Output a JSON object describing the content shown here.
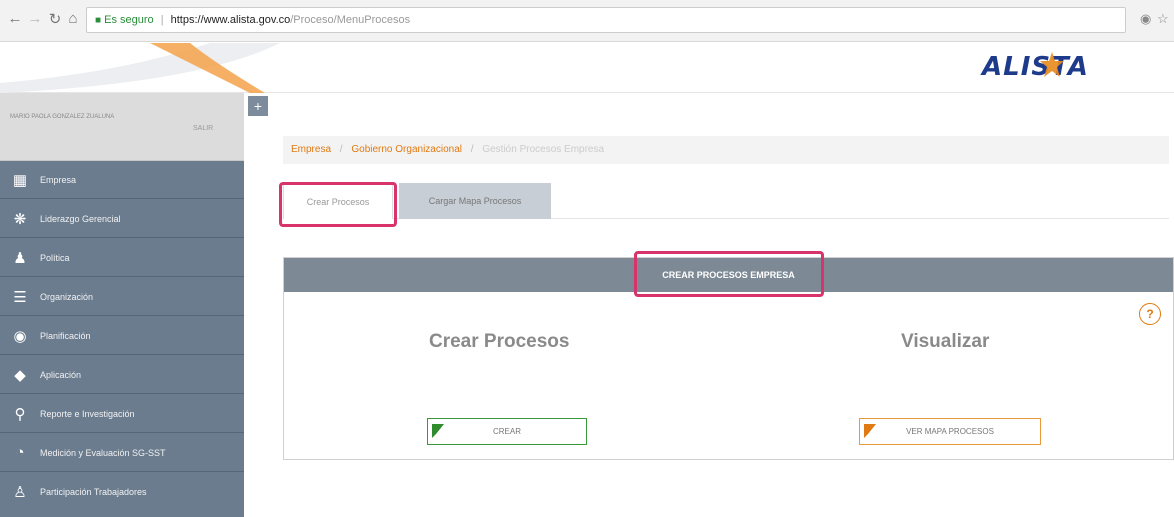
{
  "browser": {
    "secure_label": "Es seguro",
    "url_domain": "https://www.alista.gov.co",
    "url_path": "/Proceso/MenuProcesos"
  },
  "logo": {
    "text": "ALISTA"
  },
  "user": {
    "name": "MARIO PAOLA GONZALEZ ZUALUNA",
    "logout": "SALIR"
  },
  "sidebar": {
    "items": [
      {
        "label": "Empresa",
        "icon": "building-icon"
      },
      {
        "label": "Liderazgo Gerencial",
        "icon": "people-icon"
      },
      {
        "label": "Política",
        "icon": "person-icon"
      },
      {
        "label": "Organización",
        "icon": "list-icon"
      },
      {
        "label": "Planificación",
        "icon": "head-icon"
      },
      {
        "label": "Aplicación",
        "icon": "tag-icon"
      },
      {
        "label": "Reporte e Investigación",
        "icon": "search-icon"
      },
      {
        "label": "Medición y Evaluación SG-SST",
        "icon": "pie-chart-icon"
      },
      {
        "label": "Participación Trabajadores",
        "icon": "group-icon"
      }
    ]
  },
  "breadcrumb": {
    "items": [
      "Empresa",
      "Gobierno Organizacional"
    ],
    "current": "Gestión Procesos Empresa"
  },
  "tabs": [
    {
      "label": "Crear Procesos",
      "active": true
    },
    {
      "label": "Cargar Mapa Procesos",
      "active": false
    }
  ],
  "panel": {
    "header": "CREAR PROCESOS EMPRESA",
    "left_title": "Crear Procesos",
    "left_button": "CREAR",
    "right_title": "Visualizar",
    "right_button": "VER MAPA PROCESOS"
  },
  "colors": {
    "accent_orange": "#e07a12",
    "accent_green": "#2e8b2e",
    "highlight": "#d9336c",
    "sidebar": "#6b7c8f",
    "brand_blue": "#1e3b8b"
  }
}
